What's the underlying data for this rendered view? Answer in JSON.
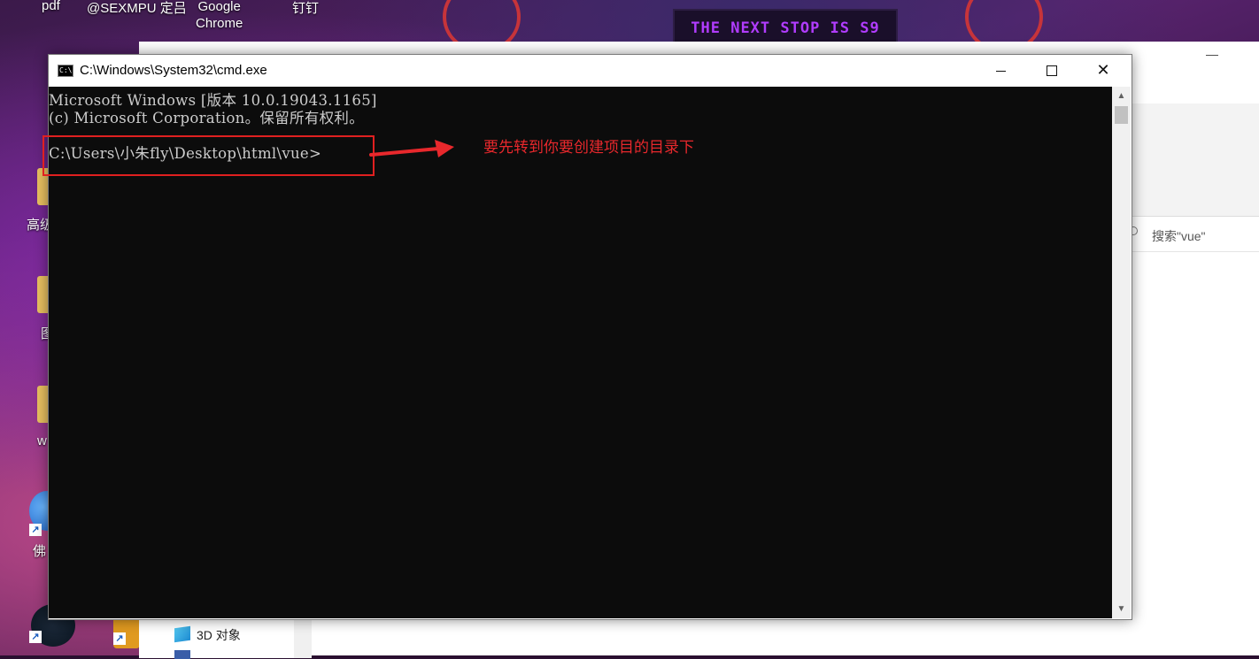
{
  "desktop": {
    "banner_text": "THE NEXT STOP IS S9",
    "icons": [
      {
        "label": "pdf"
      },
      {
        "label": "@SEXMPU 定吕"
      },
      {
        "label": "Google\nChrome"
      },
      {
        "label": "钉钉"
      },
      {
        "label": "高级"
      },
      {
        "label": "图"
      },
      {
        "label": "w"
      },
      {
        "label": "佛"
      }
    ]
  },
  "explorer": {
    "search_placeholder": "搜索\"vue\"",
    "nav_items": [
      {
        "label": "3D 对象"
      }
    ]
  },
  "cmd": {
    "title": "C:\\Windows\\System32\\cmd.exe",
    "icon_glyph": "C:\\",
    "lines": [
      "Microsoft Windows [版本 10.0.19043.1165]",
      "(c) Microsoft Corporation。保留所有权利。"
    ],
    "prompt": "C:\\Users\\小朱fly\\Desktop\\html\\vue>",
    "annotation": "要先转到你要创建项目的目录下",
    "annotation_color": "#e8282c",
    "controls": {
      "minimize": "minimize",
      "maximize": "maximize",
      "close": "close"
    }
  }
}
